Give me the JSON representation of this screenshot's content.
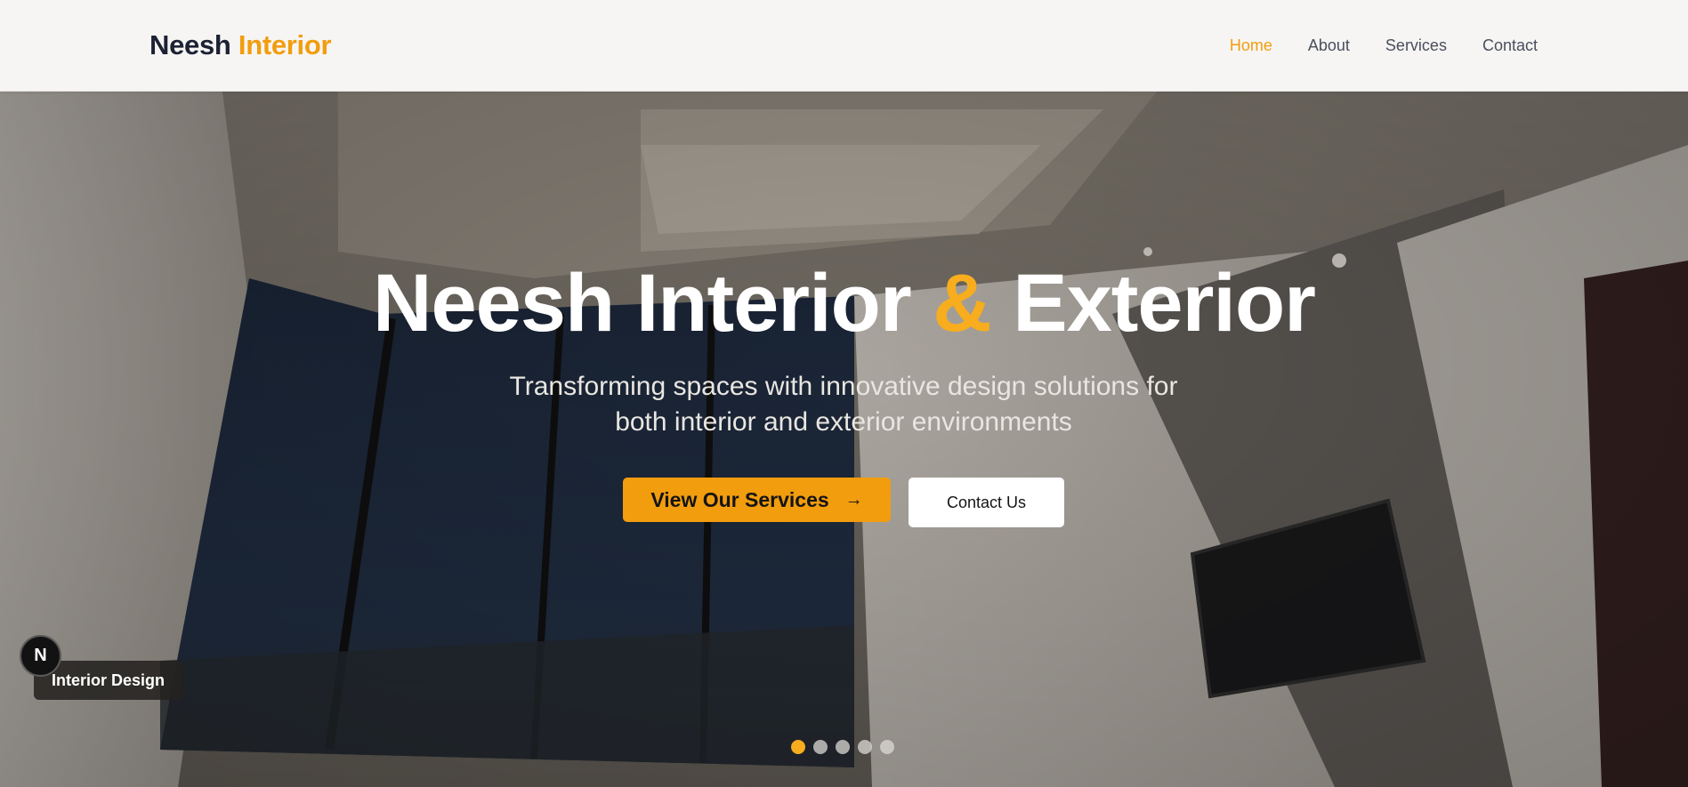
{
  "header": {
    "logo_primary": "Neesh",
    "logo_accent": "Interior",
    "nav": [
      {
        "label": "Home",
        "active": true
      },
      {
        "label": "About",
        "active": false
      },
      {
        "label": "Services",
        "active": false
      },
      {
        "label": "Contact",
        "active": false
      }
    ]
  },
  "hero": {
    "title_part1": "Neesh Interior ",
    "title_amp": "&",
    "title_part2": " Exterior",
    "subtitle_line1": "Transforming spaces with innovative design solutions for",
    "subtitle_line2": "both interior and exterior environments",
    "primary_button": "View Our Services",
    "primary_button_icon": "arrow-right-icon",
    "secondary_button": "Contact Us"
  },
  "slider": {
    "caption": "Interior Design",
    "slide_count": 5,
    "active_index": 0
  },
  "dev_badge": {
    "label": "N",
    "icon": "nextjs-logo-icon"
  },
  "colors": {
    "accent": "#f29d0e",
    "accent_light": "#f7ad1e",
    "logo_dark": "#1c2233",
    "header_bg": "#f6f5f4"
  }
}
